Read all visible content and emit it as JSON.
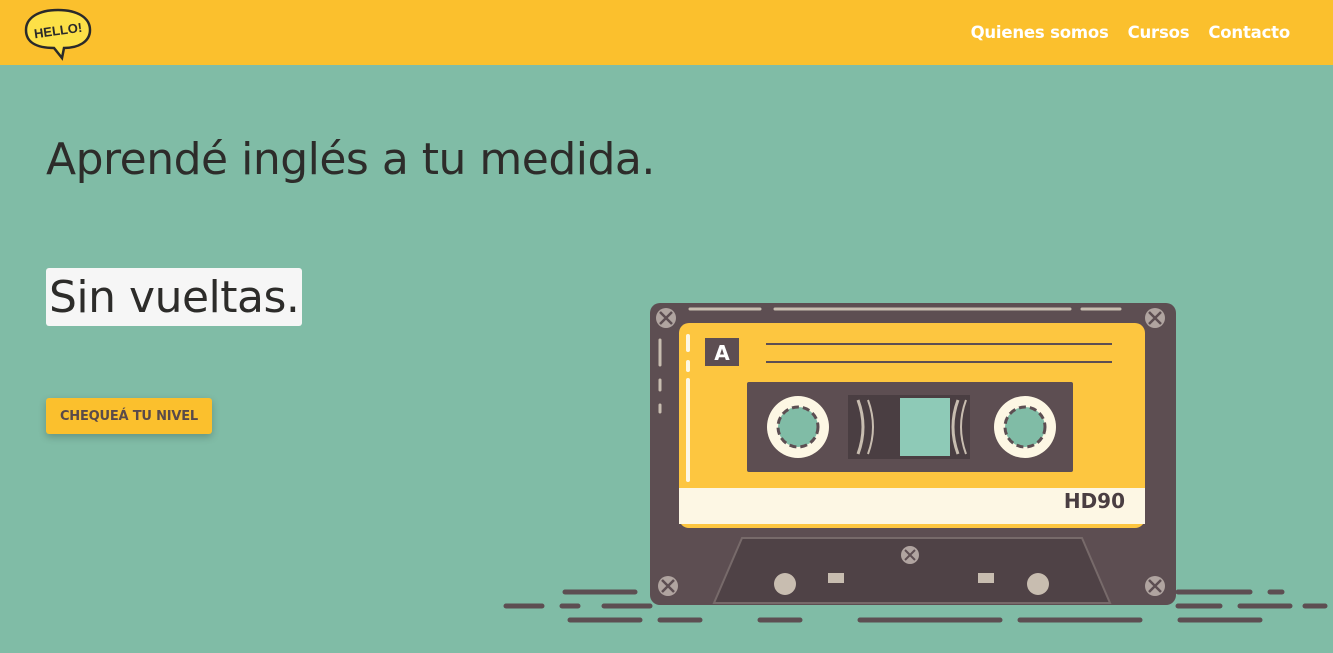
{
  "navbar": {
    "logo_text": "HELLO!",
    "links": [
      "Quienes somos",
      "Cursos",
      "Contacto"
    ]
  },
  "hero": {
    "title": "Aprendé inglés a tu medida.",
    "subtitle": "Sin vueltas.",
    "cta_label": "CHEQUEÁ TU NIVEL"
  },
  "illustration": {
    "side_label": "A",
    "tape_label": "HD90"
  },
  "colors": {
    "navbar": "#fbc02d",
    "background": "#80bca6",
    "cta": "#fbc02d",
    "cassette_body": "#5d4e52",
    "cassette_label": "#fdc640"
  }
}
